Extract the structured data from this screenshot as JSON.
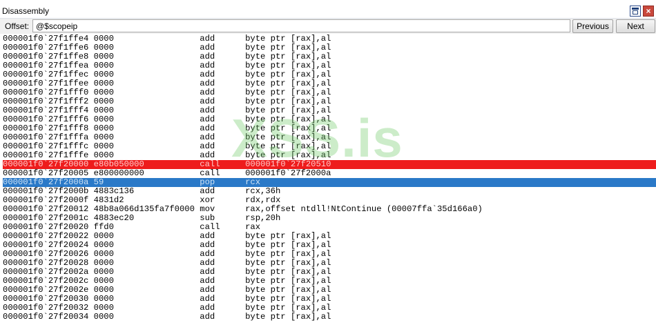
{
  "window": {
    "title": "Disassembly",
    "restore_icon": "window-restore-icon",
    "close_icon": "close-icon",
    "close_glyph": "×"
  },
  "toolbar": {
    "offset_label": "Offset:",
    "offset_value": "@$scopeip",
    "previous_label": "Previous",
    "next_label": "Next"
  },
  "disassembly": {
    "rows": [
      {
        "address": "000001f0`27f1ffe4",
        "bytes": "0000",
        "mnemonic": "add",
        "operands": "byte ptr [rax],al",
        "state": "normal"
      },
      {
        "address": "000001f0`27f1ffe6",
        "bytes": "0000",
        "mnemonic": "add",
        "operands": "byte ptr [rax],al",
        "state": "normal"
      },
      {
        "address": "000001f0`27f1ffe8",
        "bytes": "0000",
        "mnemonic": "add",
        "operands": "byte ptr [rax],al",
        "state": "normal"
      },
      {
        "address": "000001f0`27f1ffea",
        "bytes": "0000",
        "mnemonic": "add",
        "operands": "byte ptr [rax],al",
        "state": "normal"
      },
      {
        "address": "000001f0`27f1ffec",
        "bytes": "0000",
        "mnemonic": "add",
        "operands": "byte ptr [rax],al",
        "state": "normal"
      },
      {
        "address": "000001f0`27f1ffee",
        "bytes": "0000",
        "mnemonic": "add",
        "operands": "byte ptr [rax],al",
        "state": "normal"
      },
      {
        "address": "000001f0`27f1fff0",
        "bytes": "0000",
        "mnemonic": "add",
        "operands": "byte ptr [rax],al",
        "state": "normal"
      },
      {
        "address": "000001f0`27f1fff2",
        "bytes": "0000",
        "mnemonic": "add",
        "operands": "byte ptr [rax],al",
        "state": "normal"
      },
      {
        "address": "000001f0`27f1fff4",
        "bytes": "0000",
        "mnemonic": "add",
        "operands": "byte ptr [rax],al",
        "state": "normal"
      },
      {
        "address": "000001f0`27f1fff6",
        "bytes": "0000",
        "mnemonic": "add",
        "operands": "byte ptr [rax],al",
        "state": "normal"
      },
      {
        "address": "000001f0`27f1fff8",
        "bytes": "0000",
        "mnemonic": "add",
        "operands": "byte ptr [rax],al",
        "state": "normal"
      },
      {
        "address": "000001f0`27f1fffa",
        "bytes": "0000",
        "mnemonic": "add",
        "operands": "byte ptr [rax],al",
        "state": "normal"
      },
      {
        "address": "000001f0`27f1fffc",
        "bytes": "0000",
        "mnemonic": "add",
        "operands": "byte ptr [rax],al",
        "state": "normal"
      },
      {
        "address": "000001f0`27f1fffe",
        "bytes": "0000",
        "mnemonic": "add",
        "operands": "byte ptr [rax],al",
        "state": "normal"
      },
      {
        "address": "000001f0`27f20000",
        "bytes": "e80b050000",
        "mnemonic": "call",
        "operands": "000001f0`27f20510",
        "state": "breakpoint"
      },
      {
        "address": "000001f0`27f20005",
        "bytes": "e800000000",
        "mnemonic": "call",
        "operands": "000001f0`27f2000a",
        "state": "normal"
      },
      {
        "address": "000001f0`27f2000a",
        "bytes": "59",
        "mnemonic": "pop",
        "operands": "rcx",
        "state": "current"
      },
      {
        "address": "000001f0`27f2000b",
        "bytes": "4883c136",
        "mnemonic": "add",
        "operands": "rcx,36h",
        "state": "normal"
      },
      {
        "address": "000001f0`27f2000f",
        "bytes": "4831d2",
        "mnemonic": "xor",
        "operands": "rdx,rdx",
        "state": "normal"
      },
      {
        "address": "000001f0`27f20012",
        "bytes": "48b8a066d135fa7f0000",
        "mnemonic": "mov",
        "operands": "rax,offset ntdll!NtContinue (00007ffa`35d166a0)",
        "state": "normal"
      },
      {
        "address": "000001f0`27f2001c",
        "bytes": "4883ec20",
        "mnemonic": "sub",
        "operands": "rsp,20h",
        "state": "normal"
      },
      {
        "address": "000001f0`27f20020",
        "bytes": "ffd0",
        "mnemonic": "call",
        "operands": "rax",
        "state": "normal"
      },
      {
        "address": "000001f0`27f20022",
        "bytes": "0000",
        "mnemonic": "add",
        "operands": "byte ptr [rax],al",
        "state": "normal"
      },
      {
        "address": "000001f0`27f20024",
        "bytes": "0000",
        "mnemonic": "add",
        "operands": "byte ptr [rax],al",
        "state": "normal"
      },
      {
        "address": "000001f0`27f20026",
        "bytes": "0000",
        "mnemonic": "add",
        "operands": "byte ptr [rax],al",
        "state": "normal"
      },
      {
        "address": "000001f0`27f20028",
        "bytes": "0000",
        "mnemonic": "add",
        "operands": "byte ptr [rax],al",
        "state": "normal"
      },
      {
        "address": "000001f0`27f2002a",
        "bytes": "0000",
        "mnemonic": "add",
        "operands": "byte ptr [rax],al",
        "state": "normal"
      },
      {
        "address": "000001f0`27f2002c",
        "bytes": "0000",
        "mnemonic": "add",
        "operands": "byte ptr [rax],al",
        "state": "normal"
      },
      {
        "address": "000001f0`27f2002e",
        "bytes": "0000",
        "mnemonic": "add",
        "operands": "byte ptr [rax],al",
        "state": "normal"
      },
      {
        "address": "000001f0`27f20030",
        "bytes": "0000",
        "mnemonic": "add",
        "operands": "byte ptr [rax],al",
        "state": "normal"
      },
      {
        "address": "000001f0`27f20032",
        "bytes": "0000",
        "mnemonic": "add",
        "operands": "byte ptr [rax],al",
        "state": "normal"
      },
      {
        "address": "000001f0`27f20034",
        "bytes": "0000",
        "mnemonic": "add",
        "operands": "byte ptr [rax],al",
        "state": "normal"
      }
    ]
  },
  "watermark": {
    "text": "XSS.is"
  },
  "colors": {
    "current_line": "#2a79c8",
    "breakpoint_line": "#ee1c1c",
    "watermark": "#6ec864"
  }
}
